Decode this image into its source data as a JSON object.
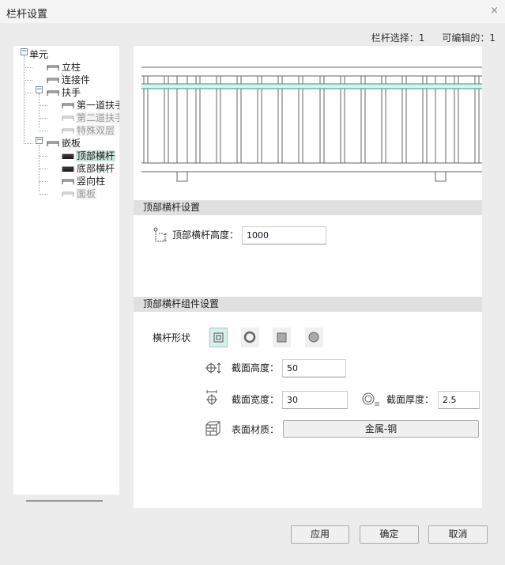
{
  "window": {
    "title": "栏杆设置",
    "close": "×"
  },
  "status": {
    "selected": "栏杆选择：1",
    "editable": "可编辑的：1"
  },
  "tree": [
    {
      "label": "单元",
      "icon": "unit-icon"
    },
    {
      "label": "立柱",
      "icon": "post-icon"
    },
    {
      "label": "连接件",
      "icon": "connector-icon"
    },
    {
      "label": "扶手",
      "icon": "handrail-icon"
    },
    {
      "label": "第一道扶手",
      "icon": "rail-icon"
    },
    {
      "label": "第二道扶手",
      "icon": "rail-icon"
    },
    {
      "label": "特殊双层",
      "icon": "rail-icon"
    },
    {
      "label": "嵌板",
      "icon": "panel-icon"
    },
    {
      "label": "顶部横杆",
      "icon": "top-bar-icon"
    },
    {
      "label": "底部横杆",
      "icon": "bottom-bar-icon"
    },
    {
      "label": "竖向柱",
      "icon": "baluster-icon"
    },
    {
      "label": "面板",
      "icon": "panel-icon"
    }
  ],
  "section1": {
    "title": "顶部横杆设置",
    "height_label": "顶部横杆高度：",
    "height_value": "1000"
  },
  "section2": {
    "title": "顶部横杆组件设置",
    "shape_label": "横杆形状",
    "shapes": [
      "hollow-square",
      "hollow-circle",
      "solid-square",
      "solid-circle"
    ],
    "selected_shape": "hollow-square",
    "sec_height_label": "截面高度：",
    "sec_height": "50",
    "sec_width_label": "截面宽度：",
    "sec_width": "30",
    "thickness_label": "截面厚度：",
    "thickness": "2.5",
    "material_label": "表面材质：",
    "material": "金属-钢"
  },
  "buttons": {
    "apply": "应用",
    "ok": "确定",
    "cancel": "取消"
  },
  "colors": {
    "highlight": "#2a9a80",
    "highlight_fill": "#d8f3ec",
    "selection": "#cbe5de"
  }
}
